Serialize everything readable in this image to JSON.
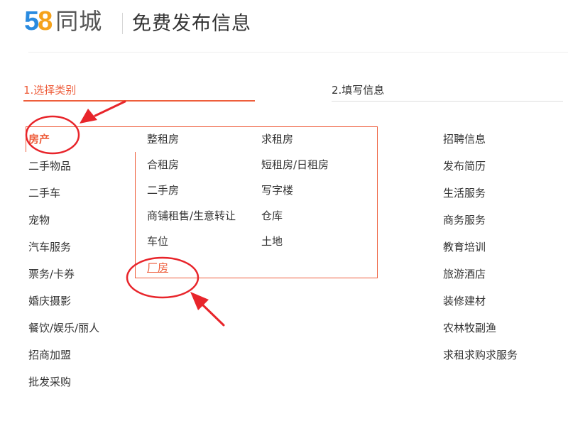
{
  "header": {
    "logo_digit_5": "5",
    "logo_digit_8": "8",
    "logo_text": "同城",
    "title": "免费发布信息"
  },
  "steps": [
    {
      "label": "1.选择类别",
      "active": true
    },
    {
      "label": "2.填写信息",
      "active": false
    }
  ],
  "categories_left": [
    "房产",
    "二手物品",
    "二手车",
    "宠物",
    "汽车服务",
    "票务/卡券",
    "婚庆摄影",
    "餐饮/娱乐/丽人",
    "招商加盟",
    "批发采购"
  ],
  "categories_right": [
    "招聘信息",
    "发布简历",
    "生活服务",
    "商务服务",
    "教育培训",
    "旅游酒店",
    "装修建材",
    "农林牧副渔",
    "求租求购求服务"
  ],
  "selected_category": "房产",
  "subcategories": {
    "col1": [
      "整租房",
      "合租房",
      "二手房",
      "商铺租售/生意转让",
      "车位",
      "厂房"
    ],
    "col2": [
      "求租房",
      "短租房/日租房",
      "写字楼",
      "仓库",
      "土地"
    ]
  },
  "highlighted_subcategory": "厂房",
  "colors": {
    "accent": "#ee5e3c",
    "annotation_red": "#e8252b",
    "logo_5": "#ea4b2a",
    "logo_8_blue": "#2a8be0",
    "logo_8_orange": "#f5a21b",
    "logo_8_green": "#4cb848"
  }
}
